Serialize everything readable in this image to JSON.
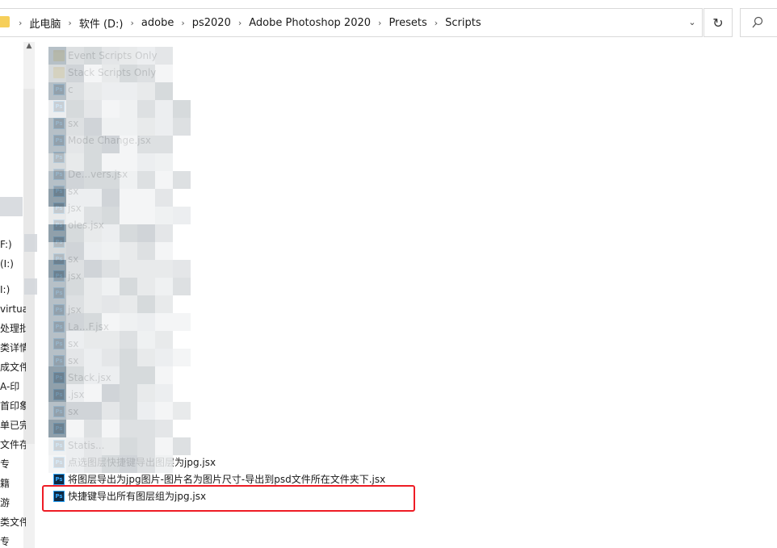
{
  "address_bar": {
    "breadcrumbs": [
      "此电脑",
      "软件 (D:)",
      "adobe",
      "ps2020",
      "Adobe Photoshop 2020",
      "Presets",
      "Scripts"
    ],
    "separator": "›",
    "dropdown_glyph": "⌄",
    "refresh_glyph": "↻"
  },
  "nav_pane": {
    "items": [
      "F:)",
      "(I:)",
      "I:)",
      "virtua",
      "处理批",
      "类详情",
      "成文件",
      "A-印",
      "首印象",
      "单已完",
      "文件存储",
      "专",
      "籍",
      "游",
      "类文件",
      "专"
    ]
  },
  "files": [
    {
      "type": "folder",
      "name": "Event Scripts Only"
    },
    {
      "type": "folder",
      "name": "Stack Scripts Only"
    },
    {
      "type": "ps",
      "name": "c"
    },
    {
      "type": "ps",
      "name": ""
    },
    {
      "type": "ps",
      "name": "sx"
    },
    {
      "type": "ps",
      "name": "Mode Change.jsx"
    },
    {
      "type": "ps",
      "name": ""
    },
    {
      "type": "ps",
      "name": "De...vers.jsx"
    },
    {
      "type": "ps",
      "name": "sx"
    },
    {
      "type": "ps",
      "name": "jsx"
    },
    {
      "type": "ps",
      "name": "oles.jsx"
    },
    {
      "type": "ps",
      "name": ""
    },
    {
      "type": "ps",
      "name": "sx"
    },
    {
      "type": "ps",
      "name": "jsx"
    },
    {
      "type": "ps",
      "name": ""
    },
    {
      "type": "ps",
      "name": "jsx"
    },
    {
      "type": "ps",
      "name": "La...F.jsx"
    },
    {
      "type": "ps",
      "name": "sx"
    },
    {
      "type": "ps",
      "name": "sx"
    },
    {
      "type": "ps",
      "name": "Stack.jsx"
    },
    {
      "type": "ps",
      "name": ".jsx"
    },
    {
      "type": "ps",
      "name": "sx"
    },
    {
      "type": "ps",
      "name": ""
    },
    {
      "type": "ps",
      "name": "Statis..."
    },
    {
      "type": "ps",
      "name": "点选图层快捷键导出图层为jpg.jsx"
    },
    {
      "type": "ps",
      "name": "将图层导出为jpg图片-图片名为图片尺寸-导出到psd文件所在文件夹下.jsx"
    },
    {
      "type": "ps",
      "name": "快捷键导出所有图层组为jpg.jsx"
    }
  ],
  "colors": {
    "highlight": "#ee1c25",
    "folder": "#f3c646",
    "ps_icon_bg": "#0e2a44",
    "ps_icon_fg": "#31a8ff"
  },
  "icons": {
    "folder": "folder-icon",
    "ps": "photoshop-script-icon"
  }
}
